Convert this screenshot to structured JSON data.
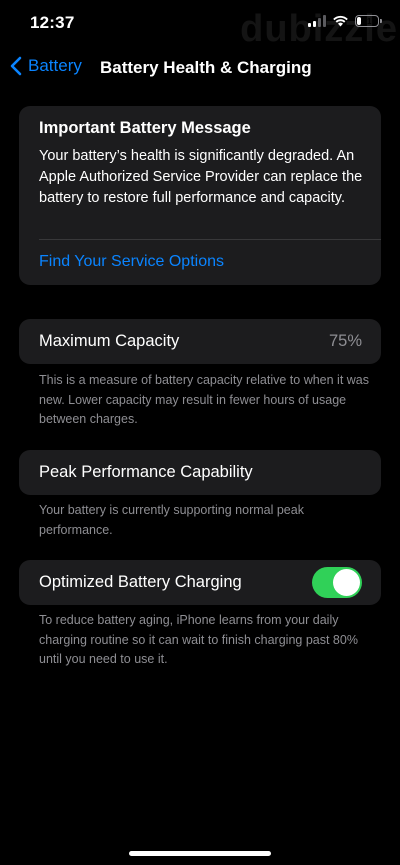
{
  "status_bar": {
    "time": "12:37",
    "battery_level": "21",
    "battery_fill_fraction": 0.21,
    "watermark": "dubizzle"
  },
  "nav": {
    "back_label": "Battery",
    "title": "Battery Health & Charging"
  },
  "message": {
    "title": "Important Battery Message",
    "body": "Your battery’s health is significantly degraded. An Apple Authorized Service Provider can replace the battery to restore full performance and capacity.",
    "link": "Find Your Service Options"
  },
  "maximum_capacity": {
    "label": "Maximum Capacity",
    "value": "75%",
    "footnote": "This is a measure of battery capacity relative to when it was new. Lower capacity may result in fewer hours of usage between charges."
  },
  "peak_performance": {
    "label": "Peak Performance Capability",
    "footnote": "Your battery is currently supporting normal peak performance."
  },
  "optimized_charging": {
    "label": "Optimized Battery Charging",
    "enabled": true,
    "footnote": "To reduce battery aging, iPhone learns from your daily charging routine so it can wait to finish charging past 80% until you need to use it."
  },
  "colors": {
    "accent": "#0a84ff",
    "toggle_on": "#30d158",
    "card_bg": "#1c1c1e",
    "secondary_text": "#8e8e93"
  }
}
